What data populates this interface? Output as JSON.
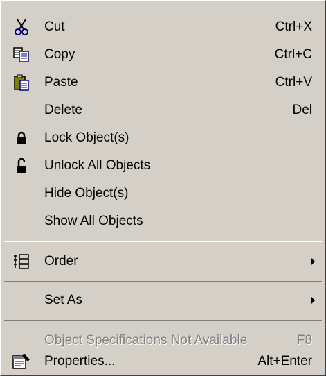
{
  "menu": {
    "items": [
      {
        "label": "Cut",
        "shortcut": "Ctrl+X",
        "icon": "scissors-icon"
      },
      {
        "label": "Copy",
        "shortcut": "Ctrl+C",
        "icon": "copy-icon"
      },
      {
        "label": "Paste",
        "shortcut": "Ctrl+V",
        "icon": "paste-icon"
      },
      {
        "label": "Delete",
        "shortcut": "Del"
      },
      {
        "label": "Lock Object(s)",
        "icon": "lock-icon"
      },
      {
        "label": "Unlock All Objects",
        "icon": "unlock-icon"
      },
      {
        "label": "Hide Object(s)"
      },
      {
        "label": "Show All Objects"
      },
      {
        "label": "Order",
        "icon": "order-icon",
        "submenu": true
      },
      {
        "label": "Set As",
        "submenu": true
      },
      {
        "label": "Object Specifications Not Available",
        "shortcut": "F8",
        "disabled": true
      },
      {
        "label": "Properties...",
        "shortcut": "Alt+Enter",
        "icon": "properties-icon"
      }
    ]
  },
  "colors": {
    "menu_background": "#d4d0c8",
    "disabled_text": "#808080",
    "highlight_white": "#ffffff"
  }
}
